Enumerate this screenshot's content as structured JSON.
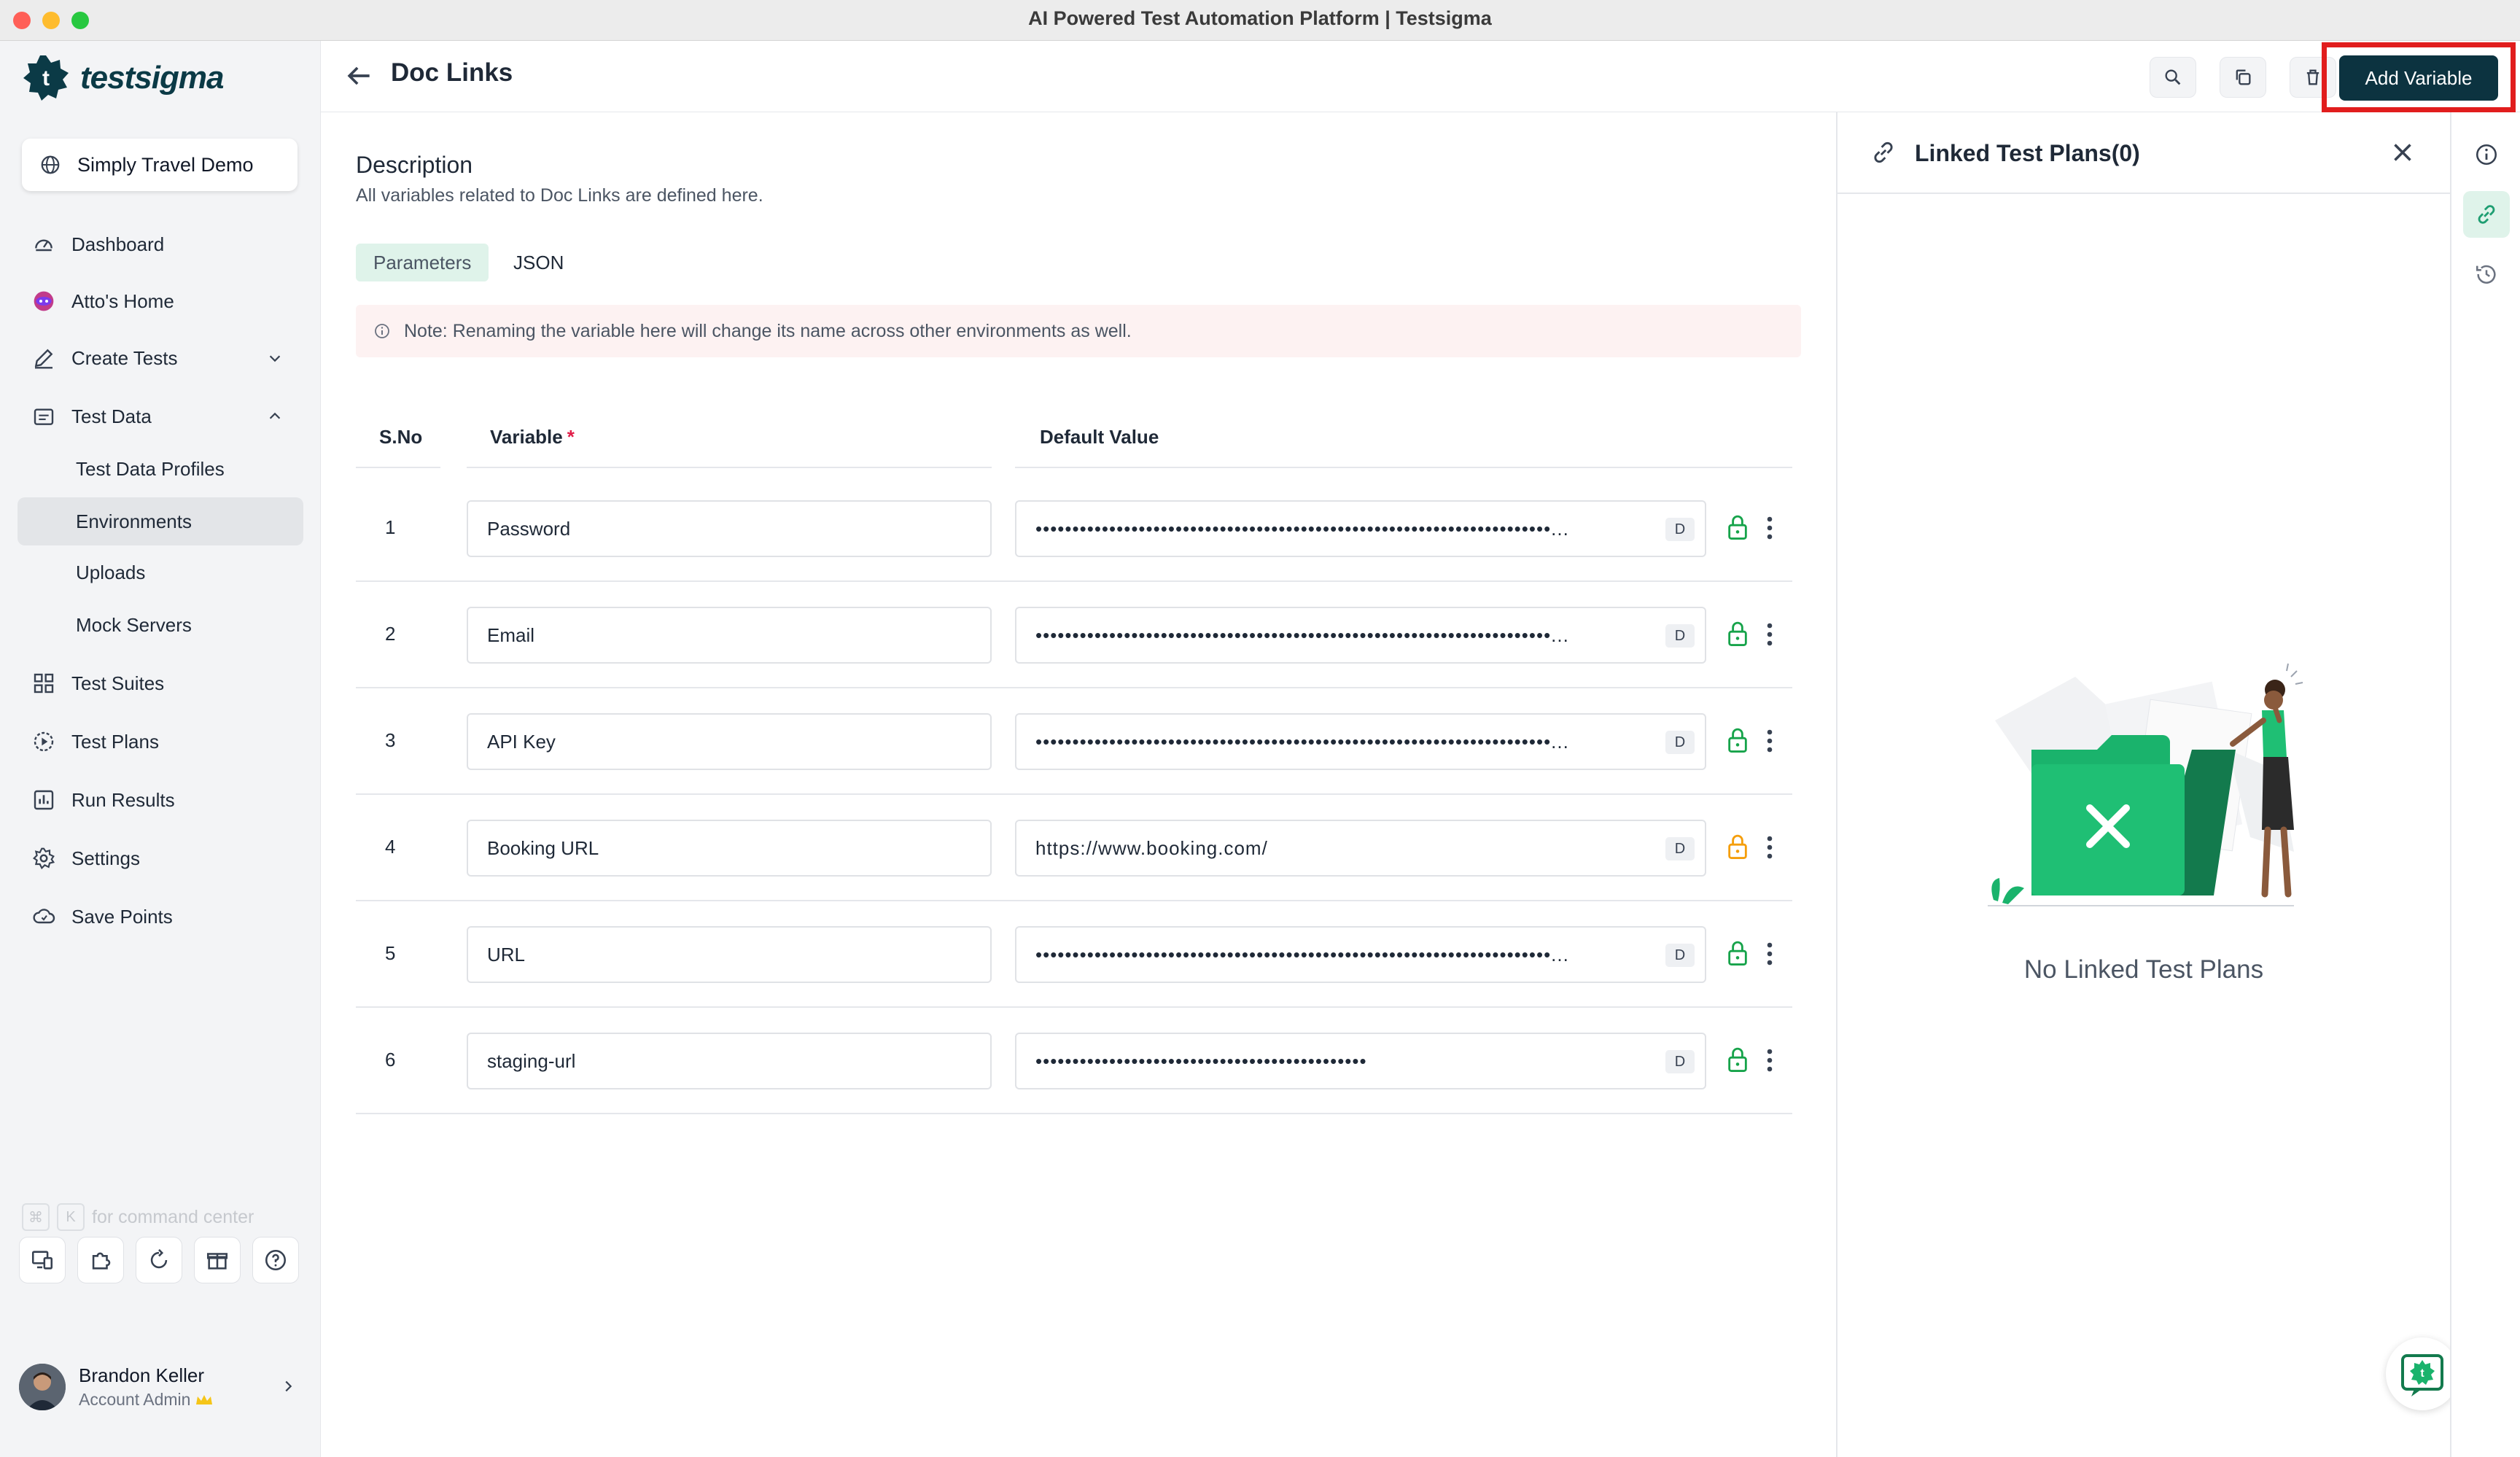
{
  "window": {
    "title": "AI Powered Test Automation Platform | Testsigma"
  },
  "brand": {
    "name": "testsigma",
    "accent": "#0c3340",
    "green": "#1f9e72"
  },
  "project": {
    "name": "Simply Travel Demo"
  },
  "sidebar": {
    "items": [
      {
        "label": "Dashboard",
        "icon": "dashboard-icon"
      },
      {
        "label": "Atto's Home",
        "icon": "atto-icon"
      },
      {
        "label": "Create Tests",
        "icon": "pencil-icon"
      },
      {
        "label": "Test Data",
        "icon": "folder-icon"
      },
      {
        "label": "Test Data Profiles"
      },
      {
        "label": "Environments"
      },
      {
        "label": "Uploads"
      },
      {
        "label": "Mock Servers"
      },
      {
        "label": "Test Suites",
        "icon": "grid-icon"
      },
      {
        "label": "Test Plans",
        "icon": "play-circle-icon"
      },
      {
        "label": "Run Results",
        "icon": "bar-chart-icon"
      },
      {
        "label": "Settings",
        "icon": "gear-icon"
      },
      {
        "label": "Save Points",
        "icon": "cloud-icon"
      }
    ],
    "command_hint": "for command center",
    "command_keys": [
      "⌘",
      "K"
    ]
  },
  "user": {
    "name": "Brandon Keller",
    "role": "Account Admin"
  },
  "header": {
    "title": "Doc Links",
    "add_button": "Add Variable"
  },
  "description": {
    "heading": "Description",
    "text": "All variables related to Doc Links are defined here."
  },
  "tabs": [
    "Parameters",
    "JSON"
  ],
  "note": "Note: Renaming the variable here will change its name across other environments as well.",
  "table": {
    "headers": {
      "sno": "S.No",
      "variable": "Variable",
      "required_mark": "*",
      "default": "Default Value"
    },
    "badge": "D",
    "rows": [
      {
        "sno": "1",
        "variable": "Password",
        "value": "••••••••••••••••••••••••••••••••••••••••••••••••••••••••••••••••••••••...",
        "lock_color": "#16a34a"
      },
      {
        "sno": "2",
        "variable": "Email",
        "value": "••••••••••••••••••••••••••••••••••••••••••••••••••••••••••••••••••••••...",
        "lock_color": "#16a34a"
      },
      {
        "sno": "3",
        "variable": "API Key",
        "value": "••••••••••••••••••••••••••••••••••••••••••••••••••••••••••••••••••••••...",
        "lock_color": "#16a34a"
      },
      {
        "sno": "4",
        "variable": "Booking URL",
        "value": "https://www.booking.com/",
        "lock_color": "#f59e0b"
      },
      {
        "sno": "5",
        "variable": "URL",
        "value": "••••••••••••••••••••••••••••••••••••••••••••••••••••••••••••••••••••••...",
        "lock_color": "#16a34a"
      },
      {
        "sno": "6",
        "variable": "staging-url",
        "value": "•••••••••••••••••••••••••••••••••••••••••••••",
        "lock_color": "#16a34a"
      }
    ]
  },
  "panel": {
    "title": "Linked Test Plans(0)",
    "empty_text": "No Linked Test Plans"
  }
}
